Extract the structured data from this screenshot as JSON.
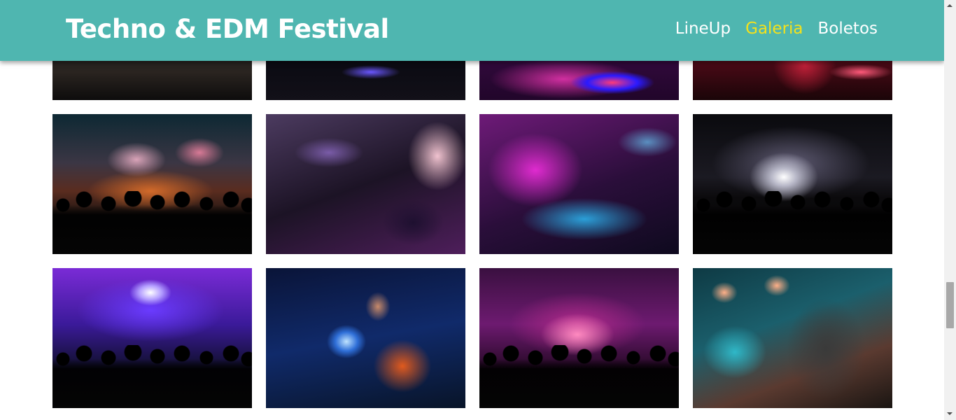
{
  "header": {
    "brand": "Techno & EDM Festival",
    "nav": [
      {
        "label": "LineUp",
        "active": false
      },
      {
        "label": "Galeria",
        "active": true
      },
      {
        "label": "Boletos",
        "active": false
      }
    ]
  },
  "colors": {
    "header_bg": "#4fb6b0",
    "nav_active": "#f3e11c",
    "text": "#ffffff"
  },
  "gallery": {
    "photos": [
      {
        "id": 1,
        "icon": "dj-turntables-photo"
      },
      {
        "id": 2,
        "icon": "dark-stage-photo"
      },
      {
        "id": 3,
        "icon": "neon-turntable-photo"
      },
      {
        "id": 4,
        "icon": "red-dj-booth-photo"
      },
      {
        "id": 5,
        "icon": "smoke-crowd-photo"
      },
      {
        "id": 6,
        "icon": "dj-mixer-photo"
      },
      {
        "id": 7,
        "icon": "purple-smoke-mixer-photo"
      },
      {
        "id": 8,
        "icon": "confetti-crowd-photo"
      },
      {
        "id": 9,
        "icon": "blue-lights-crowd-photo"
      },
      {
        "id": 10,
        "icon": "dj-headphones-photo"
      },
      {
        "id": 11,
        "icon": "pink-lasers-crowd-photo"
      },
      {
        "id": 12,
        "icon": "headphones-listener-photo"
      }
    ]
  },
  "scrollbar": {
    "scroll_position": 0.68
  }
}
